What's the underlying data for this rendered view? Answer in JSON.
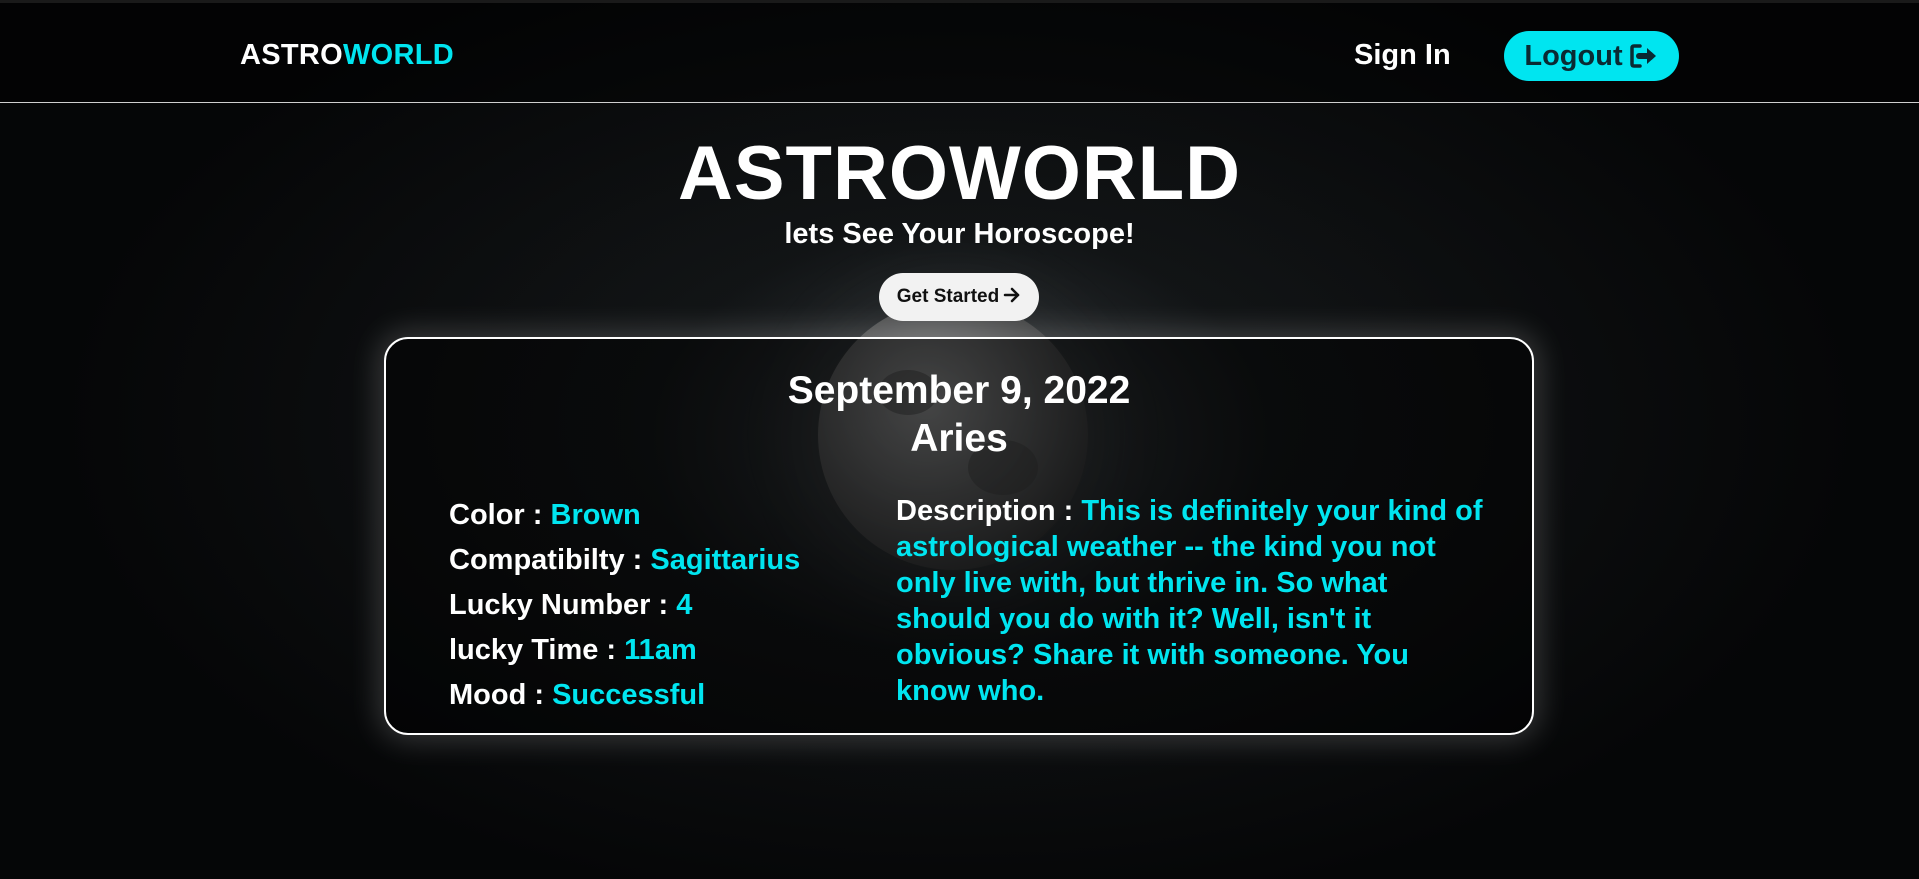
{
  "nav": {
    "brand_part1": "ASTRO",
    "brand_part2": "WORLD",
    "signin_label": "Sign In",
    "logout_label": "Logout"
  },
  "hero": {
    "title": "ASTROWORLD",
    "subtitle": "lets See Your Horoscope!",
    "cta_label": "Get Started"
  },
  "horoscope": {
    "date": "September 9, 2022",
    "sign": "Aries",
    "attributes": [
      {
        "label": "Color : ",
        "value": "Brown"
      },
      {
        "label": "Compatibilty : ",
        "value": "Sagittarius"
      },
      {
        "label": "Lucky Number : ",
        "value": "4"
      },
      {
        "label": "lucky Time : ",
        "value": "11am"
      },
      {
        "label": "Mood : ",
        "value": "Successful"
      }
    ],
    "description_label": "Description : ",
    "description": "This is definitely your kind of astrological weather -- the kind you not only live with, but thrive in. So what should you do with it? Well, isn't it obvious? Share it with someone. You know who."
  },
  "colors": {
    "accent": "#00e5f0",
    "background": "#050607",
    "text": "#ffffff"
  },
  "icons": {
    "logout": "logout-arrow-icon",
    "cta": "arrow-right-icon"
  }
}
